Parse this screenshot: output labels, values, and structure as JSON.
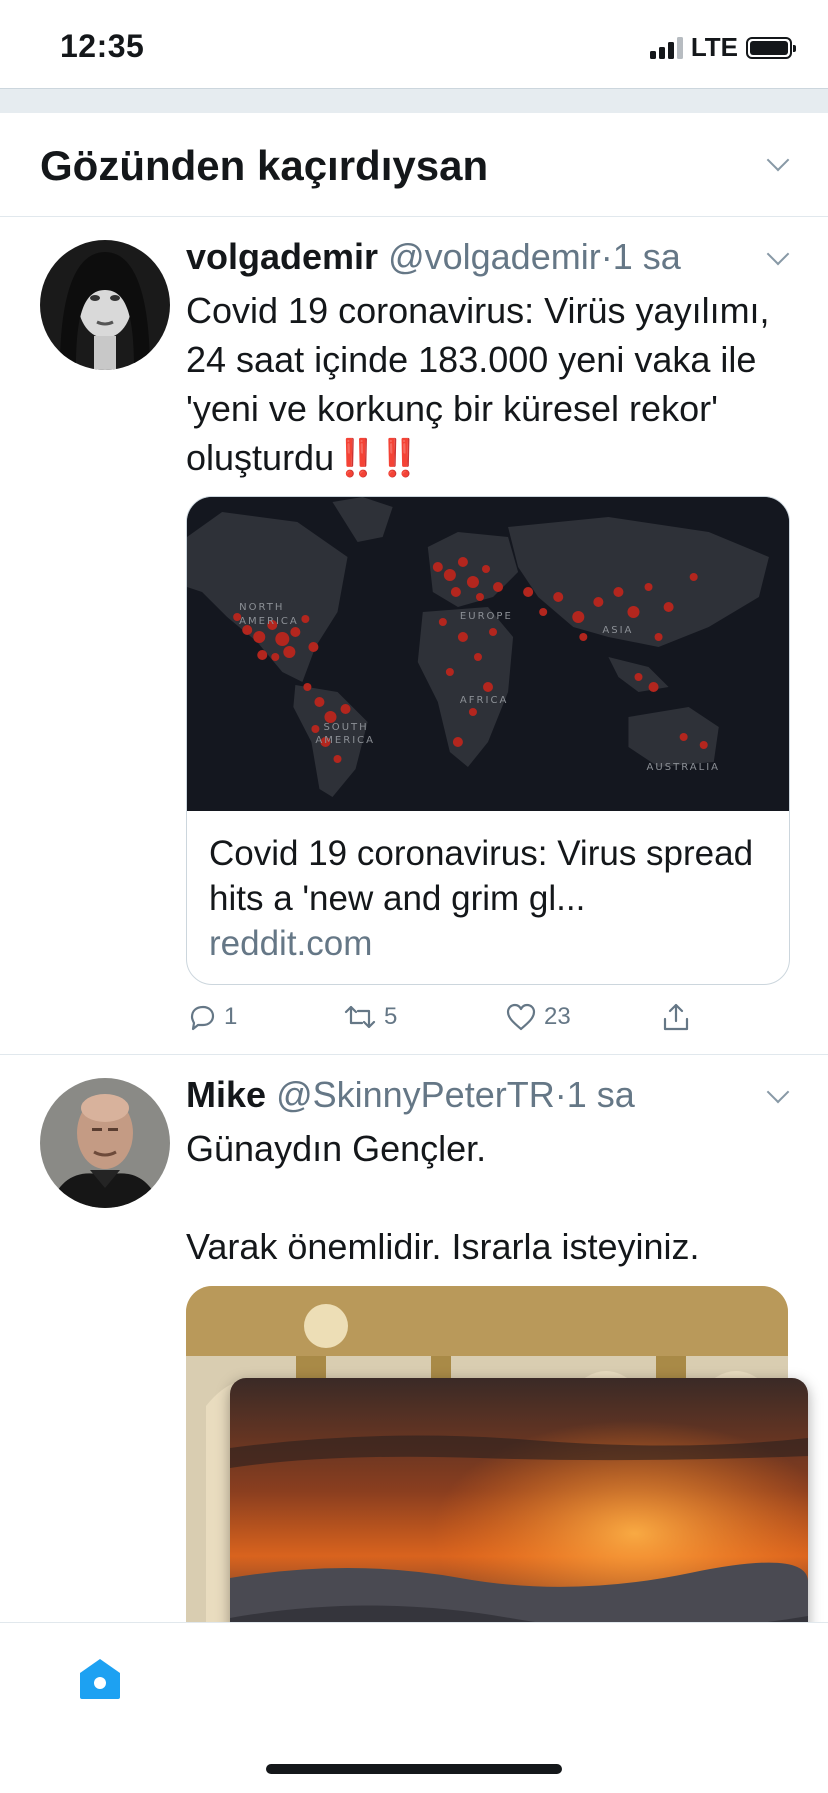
{
  "status_bar": {
    "time": "12:35",
    "network": "LTE"
  },
  "section": {
    "title": "Gözünden kaçırdıysan"
  },
  "tweets": [
    {
      "name": "volgademir",
      "handle": "@volgademir",
      "separator": "·",
      "time_ago": "1 sa",
      "text": "Covid 19 coronavirus: Virüs yayılımı, 24 saat içinde 183.000 yeni vaka ile 'yeni ve korkunç bir küresel rekor' oluşturdu",
      "emoji": "‼️‼️",
      "card": {
        "map_labels": [
          "NORTH",
          "AMERICA",
          "EUROPE",
          "ASIA",
          "AFRICA",
          "SOUTH",
          "AMERICA",
          "AUSTRALIA"
        ],
        "title": "Covid 19 coronavirus: Virus spread hits a 'new and grim gl...",
        "domain": "reddit.com"
      },
      "actions": {
        "replies": "1",
        "retweets": "5",
        "likes": "23"
      }
    },
    {
      "name": "Mike",
      "handle": "@SkinnyPeterTR",
      "separator": "·",
      "time_ago": "1 sa",
      "text": "Günaydın Gençler.\n\nVarak önemlidir. Israrla isteyiniz."
    }
  ],
  "icons": {
    "reply": "speech-bubble-icon",
    "retweet": "retweet-icon",
    "like": "heart-icon",
    "share": "share-icon",
    "home": "home-icon",
    "caret": "chevron-down-icon"
  },
  "colors": {
    "accent": "#1da1f2",
    "muted": "#657786",
    "alert": "#e0245e",
    "map_dots": "#b3261e"
  }
}
